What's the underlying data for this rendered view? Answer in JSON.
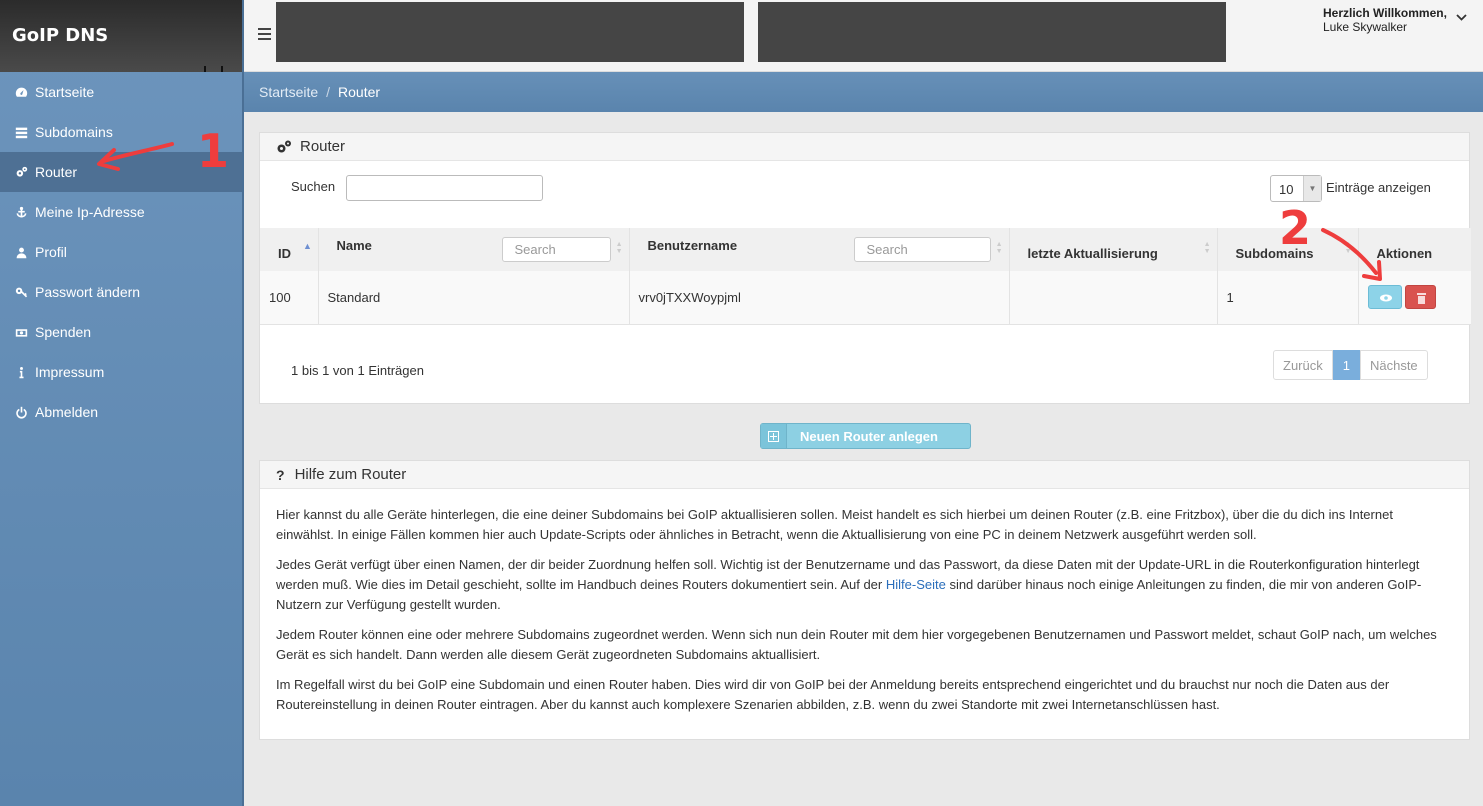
{
  "app": {
    "brand": "GoIP DNS"
  },
  "user": {
    "greeting": "Herzlich Willkommen,",
    "name": "Luke Skywalker"
  },
  "sidebar": {
    "items": [
      {
        "label": "Startseite",
        "icon": "dashboard-icon"
      },
      {
        "label": "Subdomains",
        "icon": "list-icon"
      },
      {
        "label": "Router",
        "icon": "cogs-icon",
        "active": true
      },
      {
        "label": "Meine Ip-Adresse",
        "icon": "anchor-icon"
      },
      {
        "label": "Profil",
        "icon": "user-icon"
      },
      {
        "label": "Passwort ändern",
        "icon": "key-icon"
      },
      {
        "label": "Spenden",
        "icon": "money-icon"
      },
      {
        "label": "Impressum",
        "icon": "info-icon"
      },
      {
        "label": "Abmelden",
        "icon": "power-icon"
      }
    ]
  },
  "breadcrumb": {
    "home": "Startseite",
    "current": "Router"
  },
  "router_panel": {
    "title": "Router",
    "search_label": "Suchen",
    "search_value": "",
    "page_length": "10",
    "page_length_label": "Einträge anzeigen",
    "columns": [
      "ID",
      "Name",
      "Benutzername",
      "letzte Aktuallisierung",
      "Subdomains",
      "Aktionen"
    ],
    "column_search_placeholder": "Search",
    "rows": [
      {
        "id": "100",
        "name": "Standard",
        "username": "vrv0jTXXWoypjml",
        "last_update": "",
        "subdomains": "1"
      }
    ],
    "info": "1 bis 1 von 1 Einträgen",
    "pager": {
      "prev": "Zurück",
      "current": "1",
      "next": "Nächste"
    }
  },
  "new_router_button": "Neuen Router anlegen",
  "help": {
    "title": "Hilfe zum Router",
    "p1": "Hier kannst du alle Geräte hinterlegen, die eine deiner Subdomains bei GoIP aktuallisieren sollen. Meist handelt es sich hierbei um deinen Router (z.B. eine Fritzbox), über die du dich ins Internet einwählst. In einige Fällen kommen hier auch Update-Scripts oder ähnliches in Betracht, wenn die Aktuallisierung von eine PC in deinem Netzwerk ausgeführt werden soll.",
    "p2_before": "Jedes Gerät verfügt über einen Namen, der dir beider Zuordnung helfen soll. Wichtig ist der Benutzername und das Passwort, da diese Daten mit der Update-URL in die Routerkonfiguration hinterlegt werden muß. Wie dies im Detail geschieht, sollte im Handbuch deines Routers dokumentiert sein. Auf der ",
    "p2_link": "Hilfe-Seite",
    "p2_after": " sind darüber hinaus noch einige Anleitungen zu finden, die mir von anderen GoIP-Nutzern zur Verfügung gestellt wurden.",
    "p3": "Jedem Router können eine oder mehrere Subdomains zugeordnet werden. Wenn sich nun dein Router mit dem hier vorgegebenen Benutzernamen und Passwort meldet, schaut GoIP nach, um welches Gerät es sich handelt. Dann werden alle diesem Gerät zugeordneten Subdomains aktuallisiert.",
    "p4": "Im Regelfall wirst du bei GoIP eine Subdomain und einen Router haben. Dies wird dir von GoIP bei der Anmeldung bereits entsprechend eingerichtet und du brauchst nur noch die Daten aus der Routereinstellung in deinen Router eintragen. Aber du kannst auch komplexere Szenarien abbilden, z.B. wenn du zwei Standorte mit zwei Internetanschlüssen hast."
  },
  "annotations": {
    "marker1": "1",
    "marker2": "2",
    "color": "#ee3d3d"
  }
}
